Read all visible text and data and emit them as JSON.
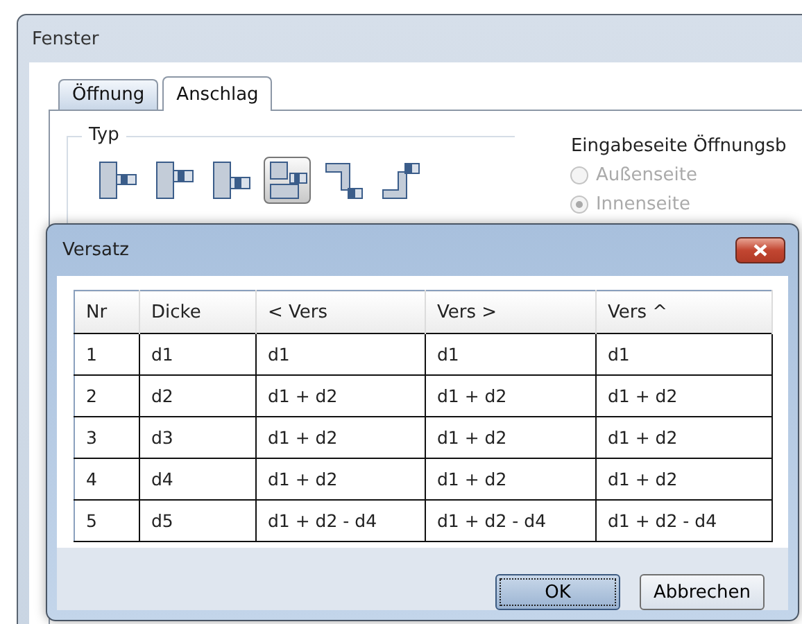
{
  "window": {
    "title": "Fenster"
  },
  "tabs": [
    {
      "label": "Öffnung",
      "selected": false
    },
    {
      "label": "Anschlag",
      "selected": true
    }
  ],
  "type_group": {
    "title": "Typ",
    "options": [
      {
        "selected": false
      },
      {
        "selected": false
      },
      {
        "selected": false
      },
      {
        "selected": true
      },
      {
        "selected": false
      },
      {
        "selected": false
      }
    ]
  },
  "input_side_group": {
    "title": "Eingabeseite Öffnungsb",
    "radios": [
      {
        "label": "Außenseite",
        "selected": false,
        "disabled": true
      },
      {
        "label": "Innenseite",
        "selected": true,
        "disabled": true
      }
    ]
  },
  "dialog": {
    "title": "Versatz",
    "table": {
      "columns": [
        "Nr",
        "Dicke",
        "< Vers",
        "Vers >",
        "Vers ^"
      ],
      "rows": [
        [
          "1",
          "d1",
          "d1",
          "d1",
          "d1"
        ],
        [
          "2",
          "d2",
          "d1 + d2",
          "d1 + d2",
          "d1 + d2"
        ],
        [
          "3",
          "d3",
          "d1 + d2",
          "d1 + d2",
          "d1 + d2"
        ],
        [
          "4",
          "d4",
          "d1 + d2",
          "d1 + d2",
          "d1 + d2"
        ],
        [
          "5",
          "d5",
          "d1 + d2 - d4",
          "d1 + d2 - d4",
          "d1 + d2 - d4"
        ]
      ]
    },
    "buttons": [
      {
        "label": "OK",
        "default": true
      },
      {
        "label": "Abbrechen",
        "default": false
      }
    ]
  }
}
